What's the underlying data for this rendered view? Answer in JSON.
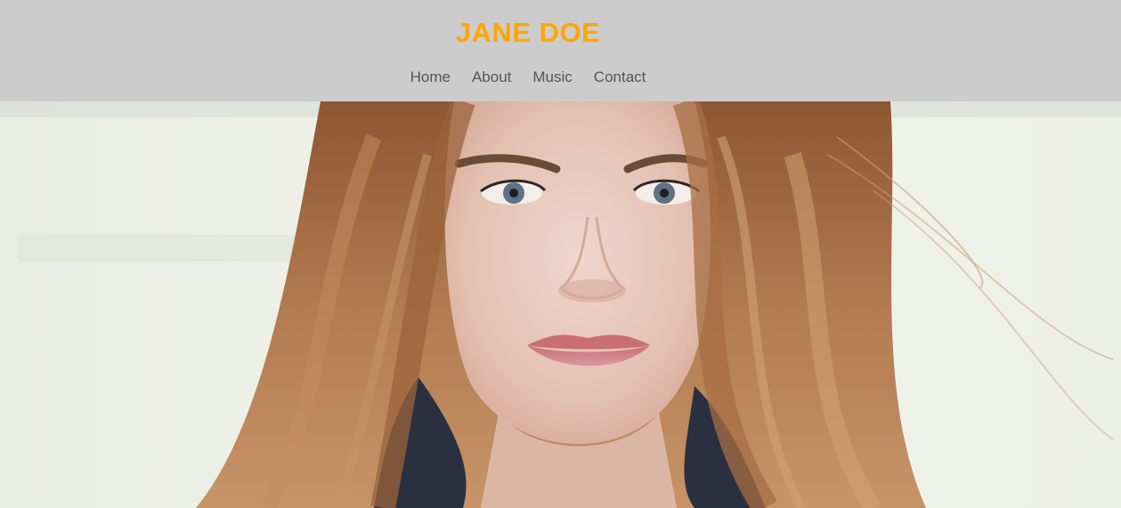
{
  "header": {
    "brand": "JANE DOE",
    "nav": [
      {
        "label": "Home"
      },
      {
        "label": "About"
      },
      {
        "label": "Music"
      },
      {
        "label": "Contact"
      }
    ]
  },
  "hero": {
    "image": "portrait-photo"
  },
  "colors": {
    "header_bg": "#cccccc",
    "brand": "#ffa500",
    "nav_text": "#555555"
  }
}
